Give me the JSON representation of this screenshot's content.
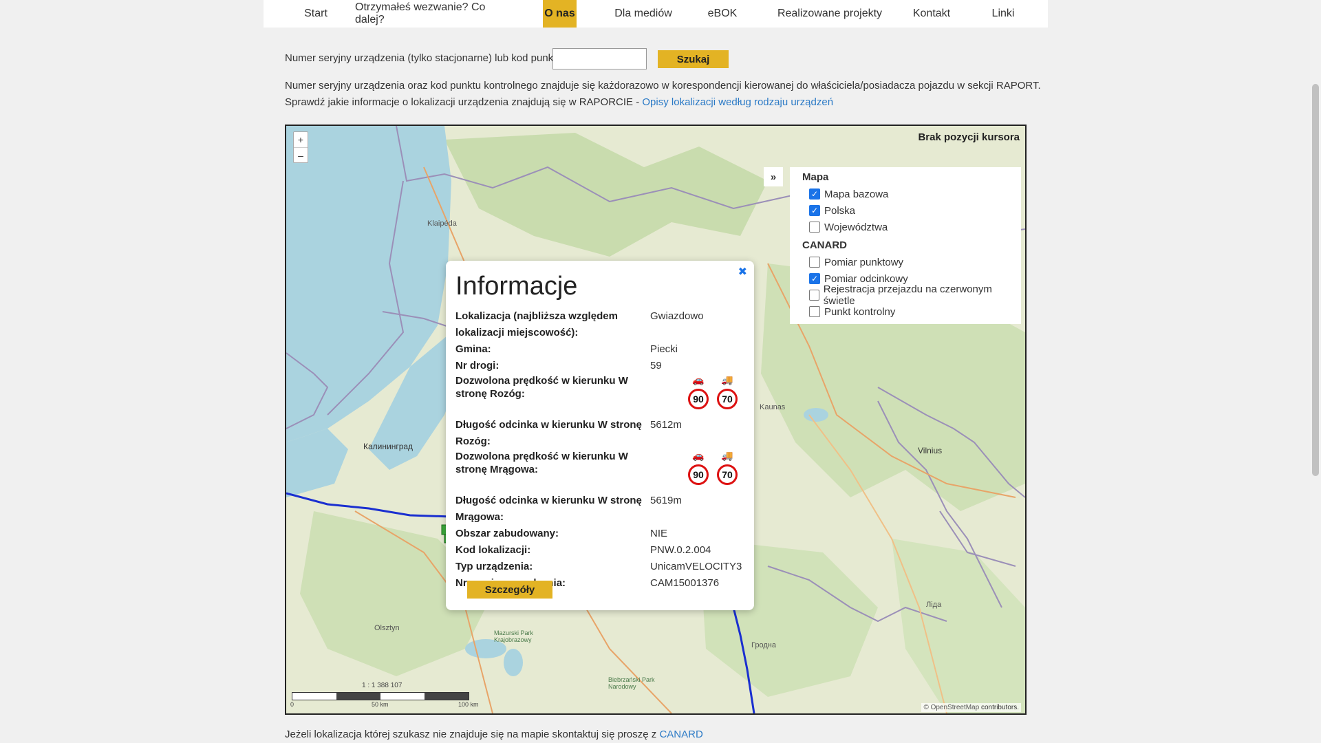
{
  "nav": {
    "items": [
      {
        "label": "Start"
      },
      {
        "label": "Otrzymałeś wezwanie? Co dalej?"
      },
      {
        "label": "O nas"
      },
      {
        "label": "Dla mediów"
      },
      {
        "label": "eBOK"
      },
      {
        "label": "Realizowane projekty"
      },
      {
        "label": "Kontakt"
      },
      {
        "label": "Linki"
      }
    ],
    "active_index": 2
  },
  "search": {
    "label": "Numer seryjny urządzenia (tylko stacjonarne) lub kod punktu:",
    "value": "",
    "button": "Szukaj"
  },
  "info": {
    "line1": "Numer seryjny urządzenia oraz kod punktu kontrolnego znajduje się każdorazowo w korespondencji kierowanej do właściciela/posiadacza pojazdu w sekcji RAPORT.",
    "line2_prefix": "Sprawdź jakie informacje o lokalizacji urządzenia znajdują się w RAPORCIE - ",
    "line2_link": "Opisy lokalizacji według rodzaju urządzeń"
  },
  "map": {
    "zoom_in": "+",
    "zoom_out": "–",
    "cursor_position": "Brak pozycji kursora",
    "layers_toggle": "»",
    "layers": {
      "group1_title": "Mapa",
      "group1": [
        {
          "label": "Mapa bazowa",
          "checked": true
        },
        {
          "label": "Polska",
          "checked": true
        },
        {
          "label": "Województwa",
          "checked": false
        }
      ],
      "group2_title": "CANARD",
      "group2": [
        {
          "label": "Pomiar punktowy",
          "checked": false
        },
        {
          "label": "Pomiar odcinkowy",
          "checked": true
        },
        {
          "label": "Rejestracja przejazdu na czerwonym świetle",
          "checked": false
        },
        {
          "label": "Punkt kontrolny",
          "checked": false
        }
      ]
    },
    "scale_text": "1 : 1 388 107",
    "scale_ticks": [
      "0",
      "50 km",
      "100 km"
    ],
    "attribution_prefix": "© OpenStreetMap",
    "attribution_link": "contributors.",
    "labels": {
      "klaipeda": "Klaipėda",
      "kaliningrad": "Калининград",
      "kaunas": "Kaunas",
      "vilnius": "Vilnius",
      "olsztyn": "Olsztyn",
      "grodno": "Гродна",
      "lida": "Ліда",
      "mazurski": "Mazurski Park Krajobrazowy",
      "biebrzanski": "Biebrzański Park Narodowy"
    }
  },
  "popup": {
    "close": "✖",
    "title": "Informacje",
    "rows": {
      "lokalizacja_k": "Lokalizacja (najbliższa względem lokalizacji miejscowość):",
      "lokalizacja_v": "Gwiazdowo",
      "gmina_k": "Gmina:",
      "gmina_v": "Piecki",
      "droga_k": "Nr drogi:",
      "droga_v": "59",
      "predkosc1_k": "Dozwolona prędkość w kierunku W stronę Rozóg:",
      "dlugosc1_k": "Długość odcinka w kierunku W stronę Rozóg:",
      "dlugosc1_v": "5612m",
      "predkosc2_k": "Dozwolona prędkość w kierunku W stronę Mrągowa:",
      "dlugosc2_k": "Długość odcinka w kierunku W stronę Mrągowa:",
      "dlugosc2_v": "5619m",
      "obszar_k": "Obszar zabudowany:",
      "obszar_v": "NIE",
      "kod_k": "Kod lokalizacji:",
      "kod_v": "PNW.0.2.004",
      "typ_k": "Typ urządzenia:",
      "typ_v": "UnicamVELOCITY3",
      "nr_k": "Nr seryjny urządzenia:",
      "nr_v": "CAM15001376"
    },
    "speeds": {
      "car1": "90",
      "truck1": "70",
      "car2": "90",
      "truck2": "70"
    },
    "details_button": "Szczegóły"
  },
  "footer": {
    "prefix": "Jeżeli lokalizacja której szukasz nie znajduje się na mapie skontaktuj się proszę z ",
    "link": "CANARD"
  }
}
